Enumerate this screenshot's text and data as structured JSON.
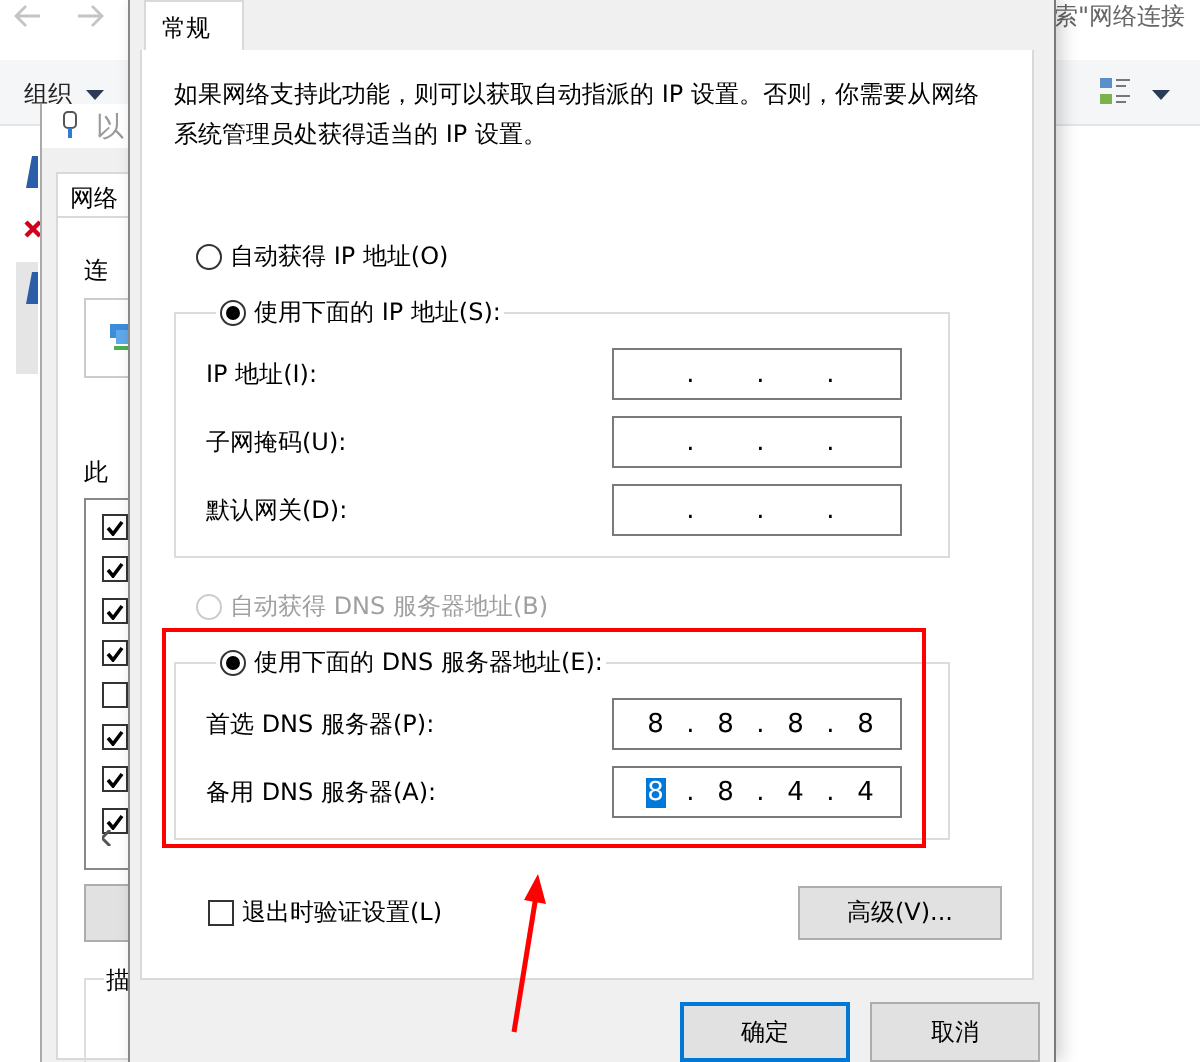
{
  "explorer": {
    "search_text": "索\"网络连接",
    "organize": "组织"
  },
  "background_dialog": {
    "title": "以",
    "tab": "网络",
    "connect_label": "连",
    "components_label": "此",
    "description_label": "描",
    "components": [
      {
        "checked": true
      },
      {
        "checked": true
      },
      {
        "checked": true
      },
      {
        "checked": true
      },
      {
        "checked": false
      },
      {
        "checked": true
      },
      {
        "checked": true
      },
      {
        "checked": true
      }
    ]
  },
  "dialog": {
    "tabs": [
      {
        "label": "常规",
        "selected": true
      }
    ],
    "description": "如果网络支持此功能，则可以获取自动指派的 IP 设置。否则，你需要从网络系统管理员处获得适当的 IP 设置。",
    "ip_mode": [
      {
        "label": "自动获得 IP 地址(O)",
        "selected": false,
        "disabled": false
      },
      {
        "label": "使用下面的 IP 地址(S):",
        "selected": true,
        "disabled": false
      }
    ],
    "ip_fields": [
      {
        "label": "IP 地址(I):",
        "dots": [
          ".",
          ".",
          "."
        ]
      },
      {
        "label": "子网掩码(U):",
        "dots": [
          ".",
          ".",
          "."
        ]
      },
      {
        "label": "默认网关(D):",
        "dots": [
          ".",
          ".",
          "."
        ]
      }
    ],
    "dns_mode": [
      {
        "label": "自动获得 DNS 服务器地址(B)",
        "selected": false,
        "disabled": true
      },
      {
        "label": "使用下面的 DNS 服务器地址(E):",
        "selected": true,
        "disabled": false
      }
    ],
    "dns_fields": [
      {
        "label": "首选 DNS 服务器(P):",
        "dots": [
          ".",
          ".",
          "."
        ],
        "octets": [
          {
            "text": "8",
            "selected": false
          },
          {
            "text": "8",
            "selected": false
          },
          {
            "text": "8",
            "selected": false
          },
          {
            "text": "8",
            "selected": false
          }
        ]
      },
      {
        "label": "备用 DNS 服务器(A):",
        "dots": [
          ".",
          ".",
          "."
        ],
        "octets": [
          {
            "text": "8",
            "selected": true
          },
          {
            "text": "8",
            "selected": false
          },
          {
            "text": "4",
            "selected": false
          },
          {
            "text": "4",
            "selected": false
          }
        ]
      }
    ],
    "validate": {
      "label": "退出时验证设置(L)",
      "checked": false
    },
    "advanced_button": "高级(V)...",
    "buttons": [
      {
        "label": "确定",
        "default": true
      },
      {
        "label": "取消",
        "default": false
      }
    ]
  },
  "annotation": {
    "kind": "box-and-arrow",
    "color": "#ff0000"
  }
}
